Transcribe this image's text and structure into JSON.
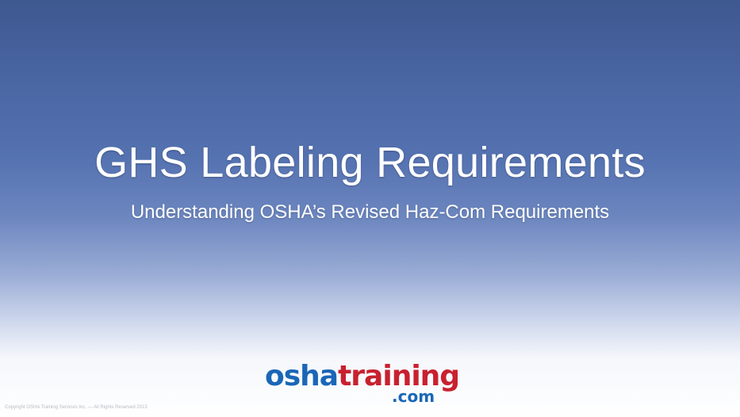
{
  "slide": {
    "title": "GHS Labeling Requirements",
    "subtitle": "Understanding OSHA’s Revised Haz-Com Requirements",
    "footer_text": "Copyright OSHA Training Services Inc. — All Rights Reserved 2013"
  },
  "logo": {
    "part_osha": "osha",
    "part_training": "training",
    "part_com": ".com",
    "colors": {
      "osha": "#1a66b7",
      "training": "#c8212f",
      "com": "#1a66b7"
    }
  },
  "colors": {
    "background_top": "#3e5890",
    "background_bottom": "#ffffff",
    "title_text": "#ffffff"
  }
}
